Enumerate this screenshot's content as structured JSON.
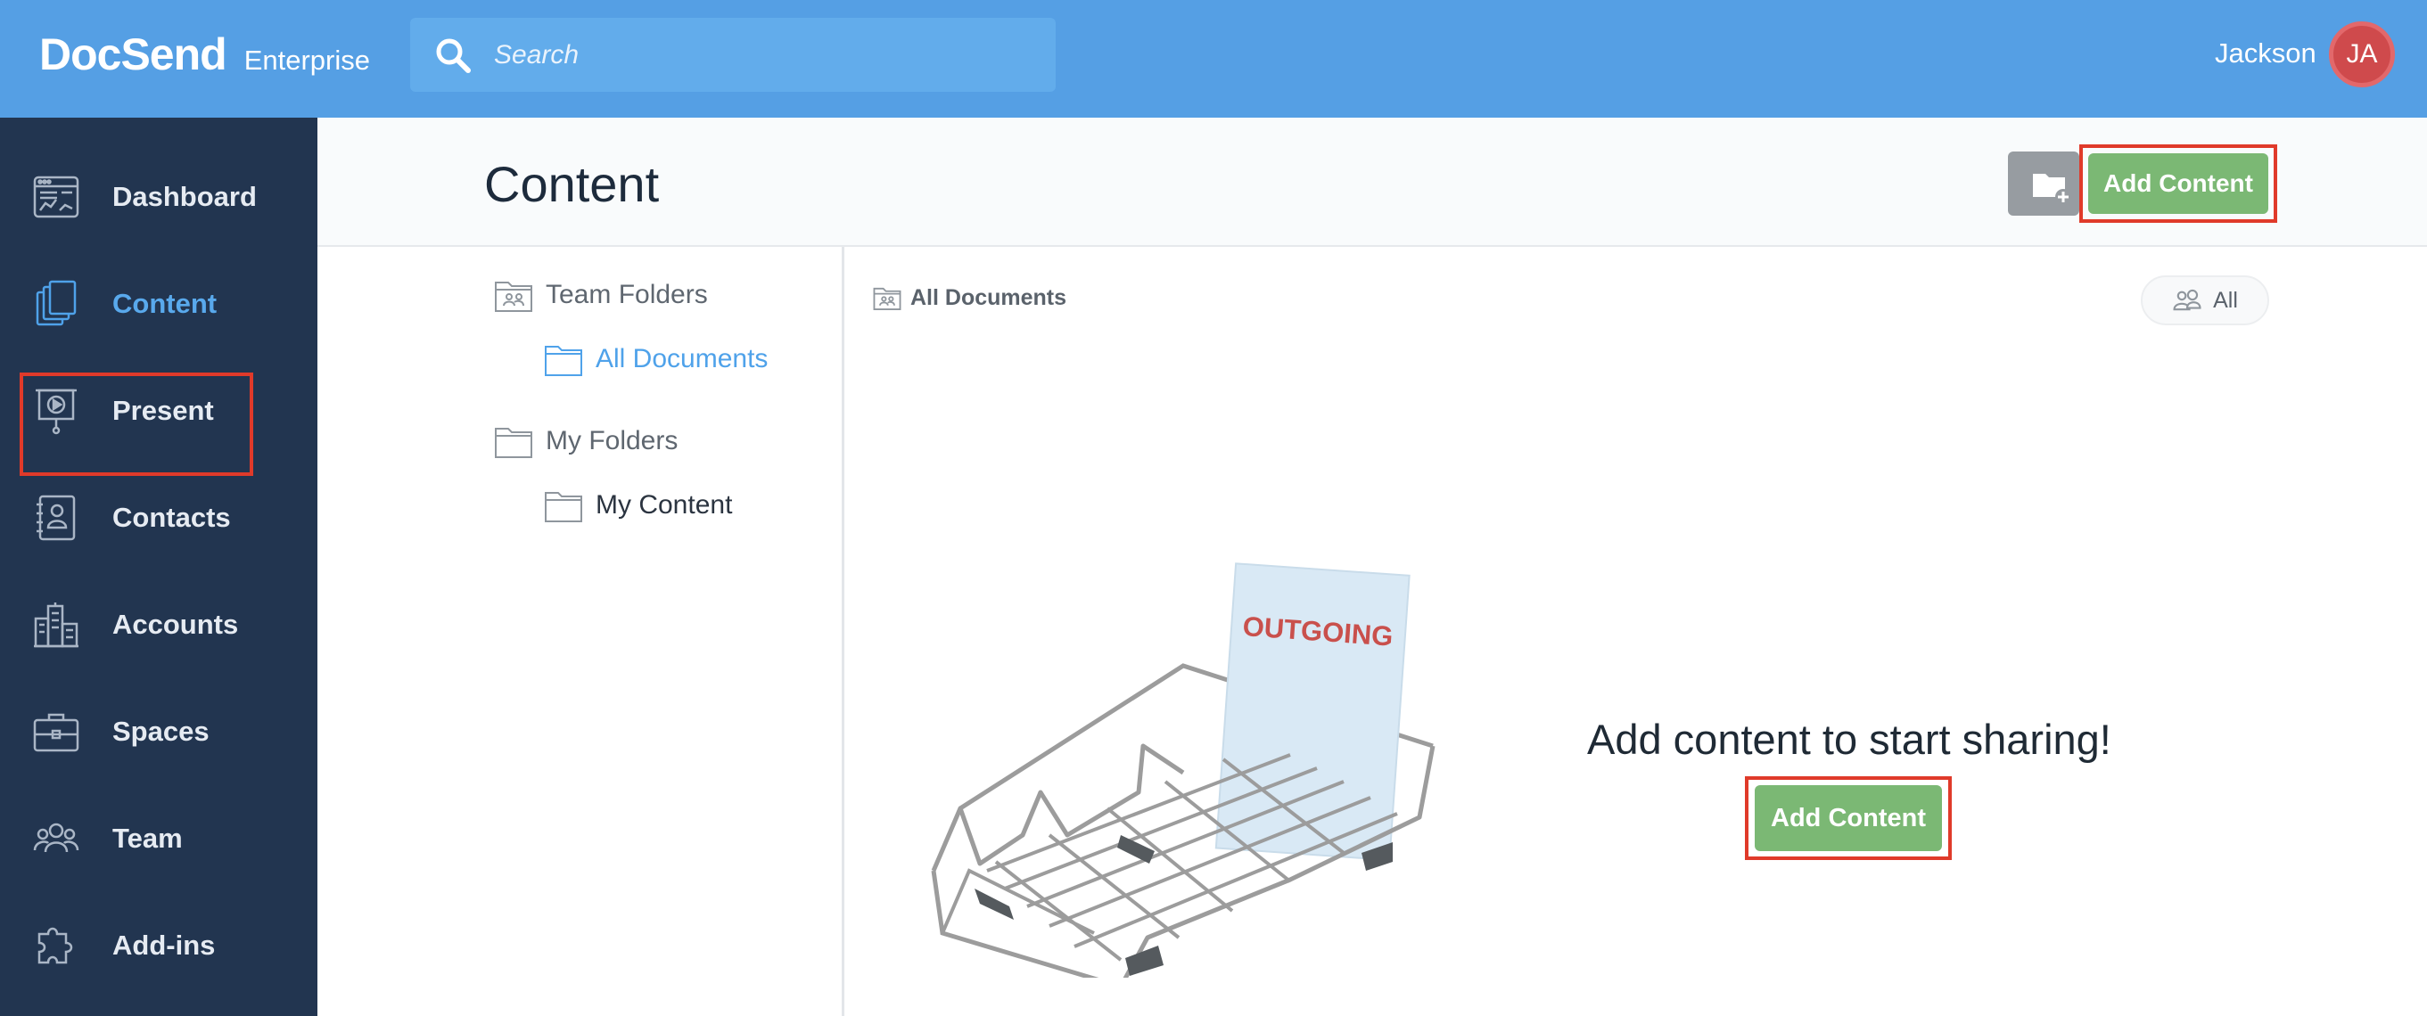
{
  "brand": {
    "logo": "DocSend",
    "edition": "Enterprise"
  },
  "search": {
    "placeholder": "Search"
  },
  "user": {
    "name": "Jackson",
    "initials": "JA"
  },
  "sidebar": {
    "items": [
      {
        "label": "Dashboard",
        "icon": "dashboard-icon"
      },
      {
        "label": "Content",
        "icon": "content-icon",
        "active": true
      },
      {
        "label": "Present",
        "icon": "present-icon"
      },
      {
        "label": "Contacts",
        "icon": "contacts-icon"
      },
      {
        "label": "Accounts",
        "icon": "accounts-icon"
      },
      {
        "label": "Spaces",
        "icon": "spaces-icon"
      },
      {
        "label": "Team",
        "icon": "team-icon"
      },
      {
        "label": "Add-ins",
        "icon": "add-ins-icon"
      }
    ]
  },
  "header": {
    "title": "Content",
    "new_folder_icon": "new-folder-icon",
    "add_content_label": "Add Content"
  },
  "folders": {
    "team_folders_label": "Team Folders",
    "all_documents_label": "All Documents",
    "my_folders_label": "My Folders",
    "my_content_label": "My Content"
  },
  "main": {
    "breadcrumb_label": "All Documents",
    "filter_label": "All",
    "tray_label": "OUTGOING",
    "empty_message": "Add content to start sharing!",
    "add_content_label": "Add Content"
  },
  "colors": {
    "topbar": "#559fe4",
    "sidebar": "#223550",
    "accent": "#4fa2ea",
    "button_green": "#7bb874",
    "highlight": "#e03a2a"
  }
}
